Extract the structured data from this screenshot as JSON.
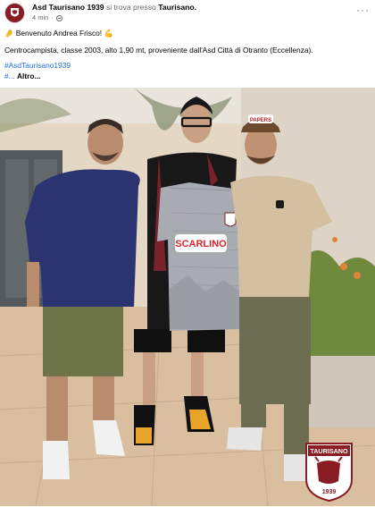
{
  "post": {
    "author": "Asd Taurisano 1939",
    "location_prefix": "si trova presso",
    "location": "Taurisano.",
    "time": "4 min",
    "separator": "·",
    "more_menu": "···",
    "welcome_emoji": "🤌",
    "welcome_text": "Benvenuto Andrea Frisco!",
    "strong_emoji": "💪",
    "description": "Centrocampista, classe 2003, alto 1,90 mt, proveniente dall'Asd Città di Otranto (Eccellenza).",
    "hashtag": "#AsdTaurisano1939",
    "more_prefix": "#...",
    "more_link": "Altro..."
  },
  "photo": {
    "jersey_sponsor": "SCARLINO",
    "cap_text": "PAPERS",
    "badge_team": "TAURISANO",
    "badge_year": "1939"
  },
  "colors": {
    "brand": "#8a1c24",
    "link": "#216fdb",
    "muted": "#65676b"
  }
}
